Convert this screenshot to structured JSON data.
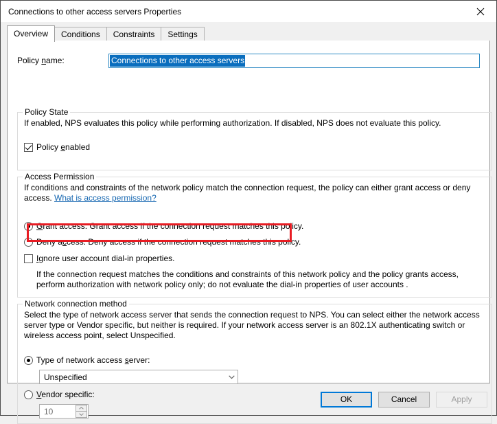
{
  "window": {
    "title": "Connections to other access servers Properties",
    "close_icon": "close-icon"
  },
  "tabs": [
    {
      "label": "Overview",
      "active": true
    },
    {
      "label": "Conditions",
      "active": false
    },
    {
      "label": "Constraints",
      "active": false
    },
    {
      "label": "Settings",
      "active": false
    }
  ],
  "policy_name": {
    "label": "Policy name:",
    "value": "Connections to other access servers",
    "selected": true
  },
  "policy_state": {
    "title": "Policy State",
    "description": "If enabled, NPS evaluates this policy while performing authorization. If disabled, NPS does not evaluate this policy.",
    "checkbox_label": "Policy enabled",
    "checked": true
  },
  "access_permission": {
    "title": "Access Permission",
    "description": "If conditions and constraints of the network policy match the connection request, the policy can either grant access or deny access.",
    "link_text": "What is access permission?",
    "grant_label": "Grant access. Grant access if the connection request matches this policy.",
    "grant_selected": true,
    "deny_label": "Deny access. Deny access if the connection request matches this policy.",
    "deny_selected": false,
    "ignore_label": "Ignore user account dial-in properties.",
    "ignore_checked": false,
    "ignore_description": "If the connection request matches the conditions and constraints of this network policy and the policy grants access, perform authorization with network policy only; do not evaluate the dial-in properties of user accounts ."
  },
  "network_connection_method": {
    "title": "Network connection method",
    "description": "Select the type of network access server that sends the connection request to NPS. You can select either the network access server type or Vendor specific, but neither is required.  If your network access server is an 802.1X authenticating switch or wireless access point, select Unspecified.",
    "type_radio_label": "Type of network access server:",
    "type_radio_selected": true,
    "type_combo_value": "Unspecified",
    "vendor_radio_label": "Vendor specific:",
    "vendor_radio_selected": false,
    "vendor_spinner_value": "10"
  },
  "footer": {
    "ok": "OK",
    "cancel": "Cancel",
    "apply": "Apply",
    "apply_disabled": true
  },
  "annotation": {
    "highlight_color": "#e81c23",
    "target": "grant-access-radio-row"
  }
}
